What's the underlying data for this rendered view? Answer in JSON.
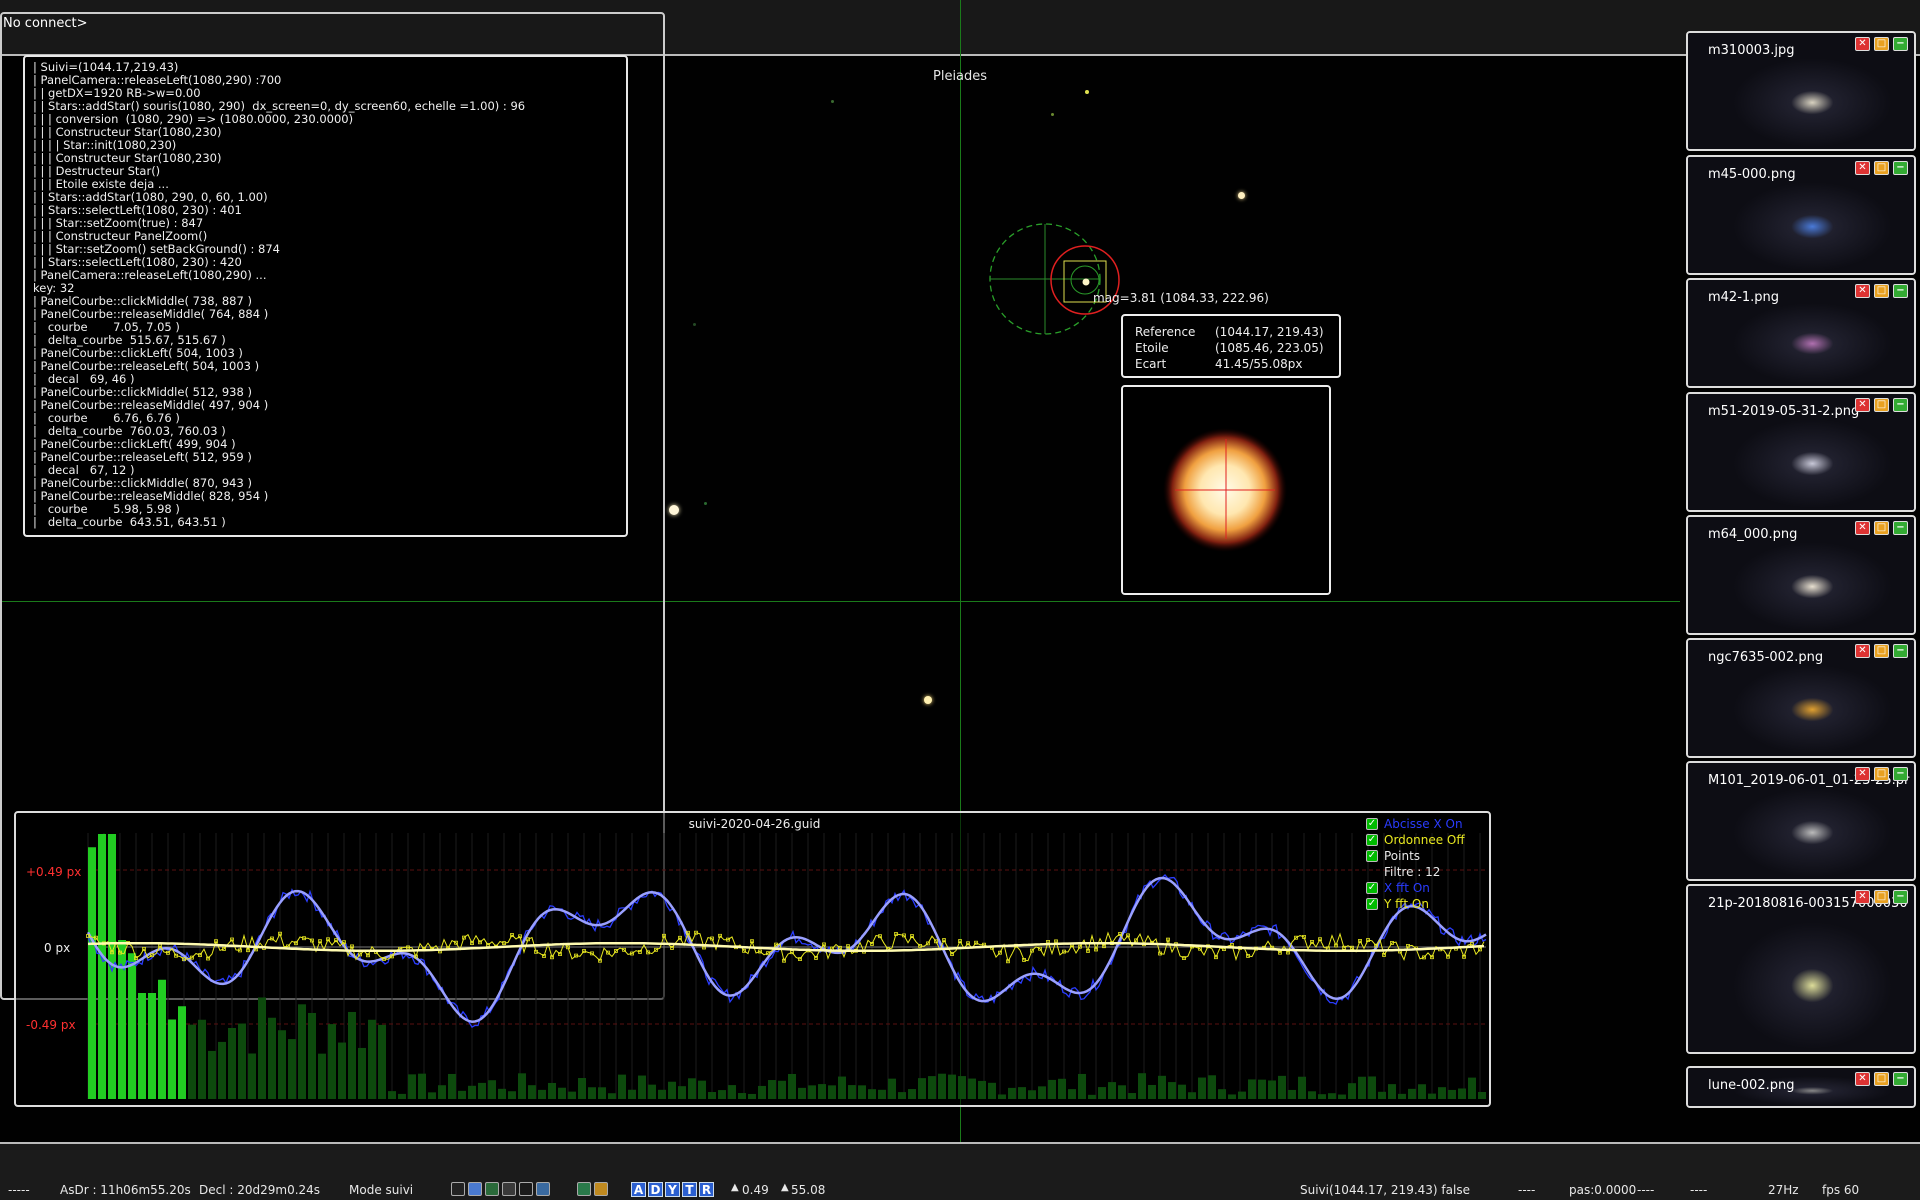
{
  "console": {
    "title": "No connect>",
    "log_lines": [
      "| Suivi=(1044.17,219.43)",
      "| PanelCamera::releaseLeft(1080,290) :700",
      "| | getDX=1920 RB->w=0.00",
      "| | Stars::addStar() souris(1080, 290)  dx_screen=0, dy_screen60, echelle =1.00) : 96",
      "| | | conversion  (1080, 290) => (1080.0000, 230.0000)",
      "| | | Constructeur Star(1080,230)",
      "| | | | Star::init(1080,230)",
      "| | | Constructeur Star(1080,230)",
      "| | | Destructeur Star()",
      "| | | Etoile existe deja ...",
      "| | Stars::addStar(1080, 290, 0, 60, 1.00)",
      "| | Stars::selectLeft(1080, 230) : 401",
      "| | | Star::setZoom(true) : 847",
      "| | | Constructeur PanelZoom()",
      "| | | Star::setZoom() setBackGround() : 874",
      "| | Stars::selectLeft(1080, 230) : 420",
      "| PanelCamera::releaseLeft(1080,290) ...",
      "key: 32",
      "| PanelCourbe::clickMiddle( 738, 887 )",
      "| PanelCourbe::releaseMiddle( 764, 884 )",
      "|   courbe       7.05, 7.05 )",
      "|   delta_courbe  515.67, 515.67 )",
      "| PanelCourbe::clickLeft( 504, 1003 )",
      "| PanelCourbe::releaseLeft( 504, 1003 )",
      "|   decal   69, 46 )",
      "| PanelCourbe::clickMiddle( 512, 938 )",
      "| PanelCourbe::releaseMiddle( 497, 904 )",
      "|   courbe       6.76, 6.76 )",
      "|   delta_courbe  760.03, 760.03 )",
      "| PanelCourbe::clickLeft( 499, 904 )",
      "| PanelCourbe::releaseLeft( 512, 959 )",
      "|   decal   67, 12 )",
      "| PanelCourbe::clickMiddle( 870, 943 )",
      "| PanelCourbe::releaseMiddle( 828, 954 )",
      "|   courbe       5.98, 5.98 )",
      "|   delta_courbe  643.51, 643.51 )"
    ]
  },
  "view": {
    "title": "Pleiades",
    "mag_label": "mag=3.81 (1084.33, 222.96)",
    "reference": {
      "rows": [
        {
          "key": "Reference",
          "value": "(1044.17, 219.43)"
        },
        {
          "key": "Etoile",
          "value": "(1085.46, 223.05)"
        },
        {
          "key": "Ecart",
          "value": "41.45/55.08px"
        }
      ]
    }
  },
  "graph": {
    "title": "suivi-2020-04-26.guid",
    "label_plus": "+0.49 px",
    "label_zero": "0 px",
    "label_minus": "-0.49 px",
    "legend": [
      {
        "label": "Abcisse X On",
        "color": "#2a3cff"
      },
      {
        "label": "Ordonnee Off",
        "color": "#e8e820"
      },
      {
        "label": "Points",
        "color": "#e8e8e8"
      },
      {
        "label": "Filtre : 12",
        "color": "#e8e8e8"
      },
      {
        "label": "X fft On",
        "color": "#2a3cff"
      },
      {
        "label": "Y fft On",
        "color": "#e8e820"
      }
    ],
    "colors": {
      "x_series": "#2a3cff",
      "x_fft": "#9aa0ff",
      "y_series": "#e8e820",
      "y_fft": "#fffbb0",
      "bars": "#22cc22"
    }
  },
  "thumbnails": [
    {
      "name": "m310003.jpg"
    },
    {
      "name": "m45-000.png"
    },
    {
      "name": "m42-1.png"
    },
    {
      "name": "m51-2019-05-31-2.png"
    },
    {
      "name": "m64_000.png"
    },
    {
      "name": "ngc7635-002.png"
    },
    {
      "name": "M101_2019-06-01_01-23-25.pr"
    },
    {
      "name": "21p-20180816-003157000030"
    },
    {
      "name": "lune-002.png"
    }
  ],
  "statusbar": {
    "dashes_left": "-----",
    "asdr": "AsDr : 11h06m55.20s",
    "decl": "Decl : 20d29m0.24s",
    "mode": "Mode suivi",
    "letter_buttons": [
      "A",
      "D",
      "Y",
      "T",
      "R"
    ],
    "val1": "0.49",
    "val2": "55.08",
    "suivi": "Suivi(1044.17, 219.43) false",
    "dashes1": "----",
    "pas": "pas:0.0000",
    "dashes2": "----",
    "dashes3": "----",
    "hz": "27Hz",
    "fps": "fps 60"
  }
}
